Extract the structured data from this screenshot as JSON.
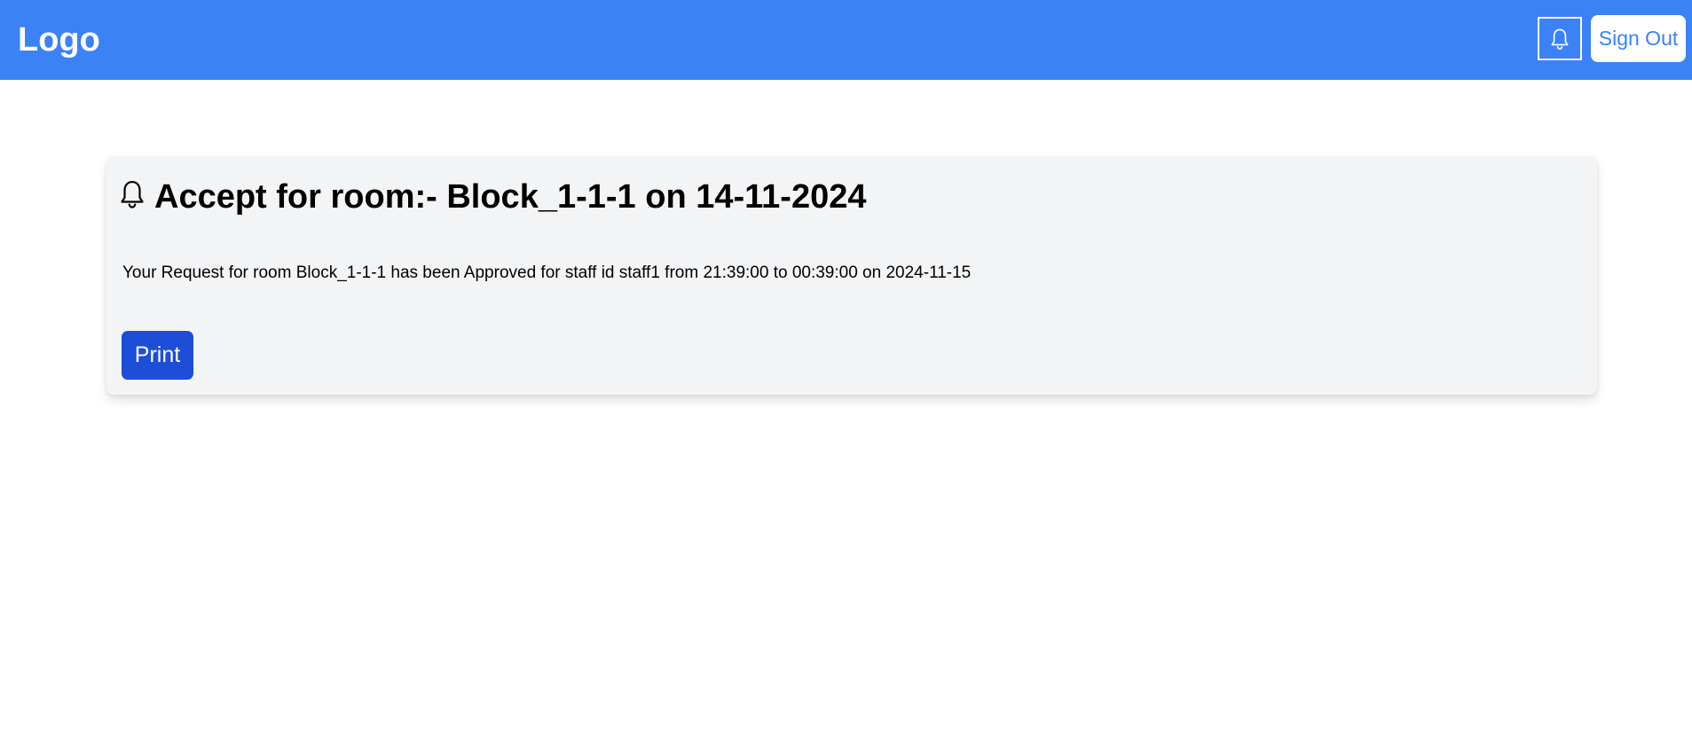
{
  "header": {
    "logo_text": "Logo",
    "notification_icon": "bell-icon",
    "sign_out_label": "Sign Out"
  },
  "notification": {
    "icon": "bell-icon",
    "title": "Accept for room:- Block_1-1-1 on 14-11-2024",
    "message": "Your Request for room Block_1-1-1 has been Approved for staff id staff1 from 21:39:00 to 00:39:00 on 2024-11-15",
    "print_label": "Print"
  },
  "colors": {
    "header_bg": "#3b82f6",
    "card_bg": "#f3f4f6",
    "print_button_bg": "#1d4ed8",
    "sign_out_text": "#3b82f6"
  }
}
